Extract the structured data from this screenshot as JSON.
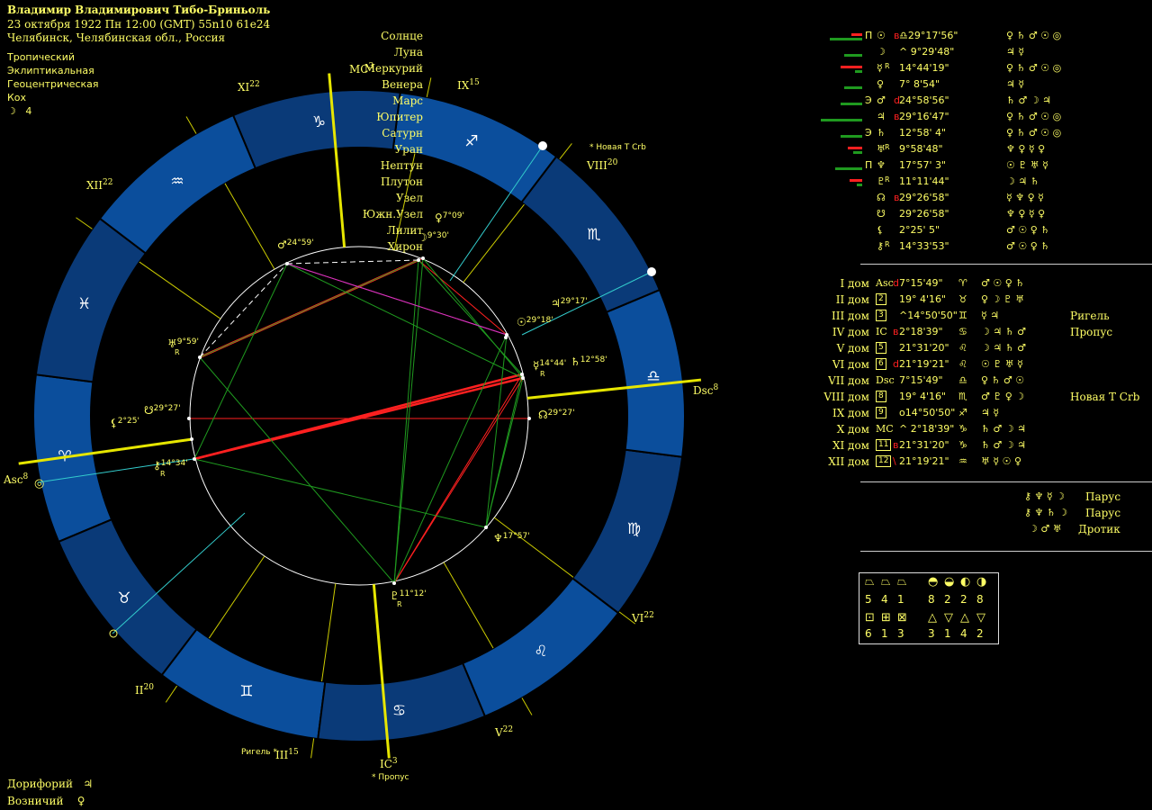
{
  "header": {
    "name": "Владимир Владимирович Тибо-Бриньоль",
    "datetime": "23 октября 1922  Пн  12:00 (GMT) 55n10  61e24",
    "place": "Челябинск, Челябинская обл., Россия"
  },
  "settings": [
    "Тропический",
    "Эклиптикальная",
    "Геоцентрическая",
    "Кох"
  ],
  "moon_phase": {
    "symbol": "☽",
    "value": "4"
  },
  "bottom_left": [
    {
      "label": "Дорифорий",
      "symbol": "♃"
    },
    {
      "label": "Возничий",
      "symbol": "♀"
    }
  ],
  "colors": {
    "accent": "#ffff66",
    "ring_light": "#0b4e9c",
    "ring_dark": "#0a3a78",
    "aspect_red": "#ff2020",
    "aspect_green": "#1f9a1f",
    "axis": "#e6e600",
    "cusp_line": "#cccc00",
    "cyan": "#33cccc",
    "magenta": "#cc33cc"
  },
  "wheel": {
    "angle_labels": {
      "mc": "MC",
      "mc_num": "3",
      "ic": "IC",
      "ic_num": "3",
      "asc": "Asc",
      "asc_num": "8",
      "dsc": "Dsc",
      "dsc_num": "8"
    },
    "house_labels": [
      {
        "roman": "XI",
        "num": "22"
      },
      {
        "roman": "IX",
        "num": "15"
      },
      {
        "roman": "XII",
        "num": "22"
      },
      {
        "roman": "VIII",
        "num": "20"
      },
      {
        "roman": "II",
        "num": "20"
      },
      {
        "roman": "III",
        "num": "15"
      },
      {
        "roman": "V",
        "num": "22"
      },
      {
        "roman": "VI",
        "num": "22"
      }
    ],
    "star_labels": [
      "Новая Т Crb",
      "Пропус",
      "Ригель"
    ],
    "planet_labels": [
      {
        "symbol": "♀",
        "deg": "7°09'"
      },
      {
        "symbol": "☽",
        "deg": "9°30'"
      },
      {
        "symbol": "♂",
        "deg": "24°59'"
      },
      {
        "symbol": "♃",
        "deg": "29°17'"
      },
      {
        "symbol": "☉",
        "deg": "29°18'"
      },
      {
        "symbol": "☿",
        "deg": "14°44'",
        "retro": "R"
      },
      {
        "symbol": "♄",
        "deg": "12°58'"
      },
      {
        "symbol": "♅",
        "deg": "9°59'",
        "retro": "R"
      },
      {
        "symbol": "☊",
        "deg": "29°27'"
      },
      {
        "symbol": "☋",
        "deg": "29°27'"
      },
      {
        "symbol": "⚸",
        "deg": "2°25'"
      },
      {
        "symbol": "⚷",
        "deg": "14°34'",
        "retro": "R"
      },
      {
        "symbol": "♆",
        "deg": "17°57'"
      },
      {
        "symbol": "♇",
        "deg": "11°12'",
        "retro": "R"
      }
    ],
    "signs": [
      "♑",
      "♐",
      "♏",
      "♎",
      "♍",
      "♌",
      "♋",
      "♊",
      "♉",
      "♈",
      "♓",
      "♒"
    ]
  },
  "planets_table": [
    {
      "name": "Солнце",
      "glyph": "☉",
      "dir": "",
      "pos": "♎29°17'56\"",
      "posmark": "в",
      "rulers": "♀ ♄ ♂ ☉ ◎",
      "kind": "П",
      "g": 36,
      "r": 12
    },
    {
      "name": "Луна",
      "glyph": "☽",
      "dir": "",
      "pos": "^ 9°29'48\"",
      "posmark": "",
      "rulers": "♃   ☿",
      "kind": "",
      "g": 20,
      "r": 0
    },
    {
      "name": "Меркурий",
      "glyph": "☿",
      "dir": "R",
      "pos": "14°44'19\"",
      "posmark": "",
      "rulers": "♀ ♄ ♂ ☉ ◎",
      "kind": "",
      "g": 8,
      "r": 24
    },
    {
      "name": "Венера",
      "glyph": "♀",
      "dir": "",
      "pos": "7° 8'54\"",
      "posmark": "",
      "rulers": "♃   ☿",
      "kind": "",
      "g": 20,
      "r": 0
    },
    {
      "name": "Марс",
      "glyph": "♂",
      "dir": "",
      "pos": "24°58'56\"",
      "posmark": "d",
      "rulers": "♄ ♂ ☽ ♃",
      "kind": "Э",
      "g": 24,
      "r": 0
    },
    {
      "name": "Юпитер",
      "glyph": "♃",
      "dir": "",
      "pos": "29°16'47\"",
      "posmark": "в",
      "rulers": "♀ ♄ ♂ ☉ ◎",
      "kind": "",
      "g": 46,
      "r": 0
    },
    {
      "name": "Сатурн",
      "glyph": "♄",
      "dir": "",
      "pos": "12°58' 4\"",
      "posmark": "",
      "rulers": "♀ ♄ ♂ ☉ ◎",
      "kind": "Э",
      "g": 24,
      "r": 0
    },
    {
      "name": "Уран",
      "glyph": "♅",
      "dir": "R",
      "pos": "9°58'48\"",
      "posmark": "",
      "rulers": "♆ ♀ ☿ ♀",
      "kind": "",
      "g": 10,
      "r": 16
    },
    {
      "name": "Нептун",
      "glyph": "♆",
      "dir": "",
      "pos": "17°57' 3\"",
      "posmark": "",
      "rulers": "☉ ♇ ♅ ☿",
      "kind": "П",
      "g": 30,
      "r": 0
    },
    {
      "name": "Плутон",
      "glyph": "♇",
      "dir": "R",
      "pos": "11°11'44\"",
      "posmark": "",
      "rulers": "☽ ♃ ♄",
      "kind": "",
      "g": 6,
      "r": 14
    },
    {
      "name": "Узел",
      "glyph": "☊",
      "dir": "",
      "pos": "29°26'58\"",
      "posmark": "в",
      "rulers": "☿ ♆ ♀ ☿",
      "kind": "",
      "g": 0,
      "r": 0
    },
    {
      "name": "Южн.Узел",
      "glyph": "☋",
      "dir": "",
      "pos": "29°26'58\"",
      "posmark": "",
      "rulers": "♆ ♀ ☿ ♀",
      "kind": "",
      "g": 0,
      "r": 0
    },
    {
      "name": "Лилит",
      "glyph": "⚸",
      "dir": "",
      "pos": "2°25' 5\"",
      "posmark": "",
      "rulers": "♂ ☉ ♀ ♄",
      "kind": "",
      "g": 0,
      "r": 0
    },
    {
      "name": "Хирон",
      "glyph": "⚷",
      "dir": "R",
      "pos": "14°33'53\"",
      "posmark": "",
      "rulers": "♂ ☉ ♀ ♄",
      "kind": "",
      "g": 0,
      "r": 0
    }
  ],
  "houses_table": [
    {
      "name": "I дом",
      "cusp": "Asc",
      "pos": "7°15'49\"",
      "mark": "d",
      "sign": "♈",
      "rulers": "♂ ☉ ♀ ♄",
      "star": ""
    },
    {
      "name": "II дом",
      "cusp": "2",
      "pos": "19° 4'16\"",
      "mark": "",
      "sign": "♉",
      "rulers": "♀ ☽ ♇ ♅",
      "star": ""
    },
    {
      "name": "III дом",
      "cusp": "3",
      "pos": "^14°50'50\"",
      "mark": "",
      "sign": "♊",
      "rulers": "☿   ♃",
      "star": "Ригель"
    },
    {
      "name": "IV дом",
      "cusp": "IC",
      "pos": "2°18'39\"",
      "mark": "в",
      "sign": "♋",
      "rulers": "☽ ♃ ♄ ♂",
      "star": "Пропус"
    },
    {
      "name": "V дом",
      "cusp": "5",
      "pos": "21°31'20\"",
      "mark": "",
      "sign": "♌",
      "rulers": "☽ ♃ ♄ ♂",
      "star": ""
    },
    {
      "name": "VI дом",
      "cusp": "6",
      "pos": "21°19'21\"",
      "mark": "d",
      "sign": "♌",
      "rulers": "☉ ♇ ♅ ☿",
      "star": ""
    },
    {
      "name": "VII дом",
      "cusp": "Dsc",
      "pos": "7°15'49\"",
      "mark": "",
      "sign": "♎",
      "rulers": "♀ ♄ ♂ ☉",
      "star": ""
    },
    {
      "name": "VIII дом",
      "cusp": "8",
      "pos": "19° 4'16\"",
      "mark": "",
      "sign": "♏",
      "rulers": "♂ ♇ ♀ ☽",
      "star": "Новая Т Crb"
    },
    {
      "name": "IX дом",
      "cusp": "9",
      "pos": "о14°50'50\"",
      "mark": "",
      "sign": "♐",
      "rulers": "♃   ☿",
      "star": ""
    },
    {
      "name": "X дом",
      "cusp": "MC",
      "pos": "^ 2°18'39\"",
      "mark": "",
      "sign": "♑",
      "rulers": "♄ ♂ ☽ ♃",
      "star": ""
    },
    {
      "name": "XI дом",
      "cusp": "11",
      "pos": "21°31'20\"",
      "mark": "в",
      "sign": "♑",
      "rulers": "♄ ♂ ☽ ♃",
      "star": ""
    },
    {
      "name": "XII дом",
      "cusp": "12",
      "pos": "21°19'21\"",
      "mark": "\\",
      "sign": "♒",
      "rulers": "♅ ☿ ☉ ♀",
      "star": ""
    }
  ],
  "configurations": [
    {
      "symbols": "⚷ ♆ ☿ ☽",
      "name": "Парус"
    },
    {
      "symbols": "⚷ ♆ ♄ ☽",
      "name": "Парус"
    },
    {
      "symbols": "☽ ♂ ♅",
      "name": "Дротик"
    }
  ],
  "stats_box": {
    "row1_icons": [
      "⏢",
      "⏢",
      "⏢",
      "◓",
      "◒",
      "◐",
      "◑"
    ],
    "row1_vals": [
      "5",
      "4",
      "1",
      "8",
      "2",
      "2",
      "8"
    ],
    "row2_icons": [
      "⊡",
      "⊞",
      "⊠",
      "△",
      "▽",
      "△",
      "▽"
    ],
    "row2_vals": [
      "6",
      "1",
      "3",
      "3",
      "1",
      "4",
      "2"
    ]
  }
}
